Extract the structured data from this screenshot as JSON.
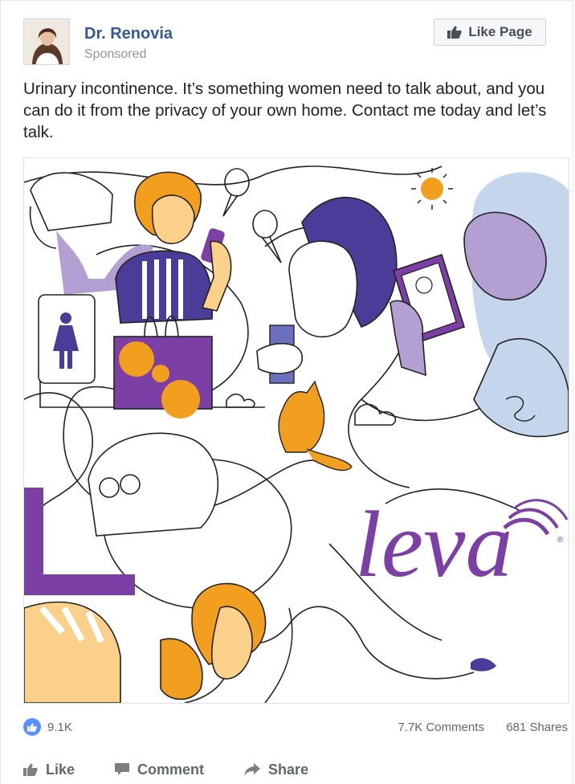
{
  "post": {
    "author": "Dr. Renovia",
    "sponsored": "Sponsored",
    "like_page": "Like Page",
    "text": "Urinary incontinence. It’s something women need to talk about, and you can do it from the privacy of your own home. Contact me today and let’s talk."
  },
  "ad_image": {
    "brand": "leva",
    "registered_mark": "®"
  },
  "stats": {
    "reactions": "9.1K",
    "comments": "7.7K Comments",
    "shares": "681 Shares"
  },
  "actions": {
    "like": "Like",
    "comment": "Comment",
    "share": "Share"
  },
  "colors": {
    "link": "#365899",
    "purple": "#7b3fa6",
    "orange": "#f29e1f",
    "lilac": "#b39fd1",
    "light_blue": "#c5d6ec",
    "indigo": "#4b3c9a",
    "peach": "#fbd08a"
  },
  "icons": [
    "thumbs-up-icon",
    "comment-icon",
    "share-arrow-icon"
  ]
}
